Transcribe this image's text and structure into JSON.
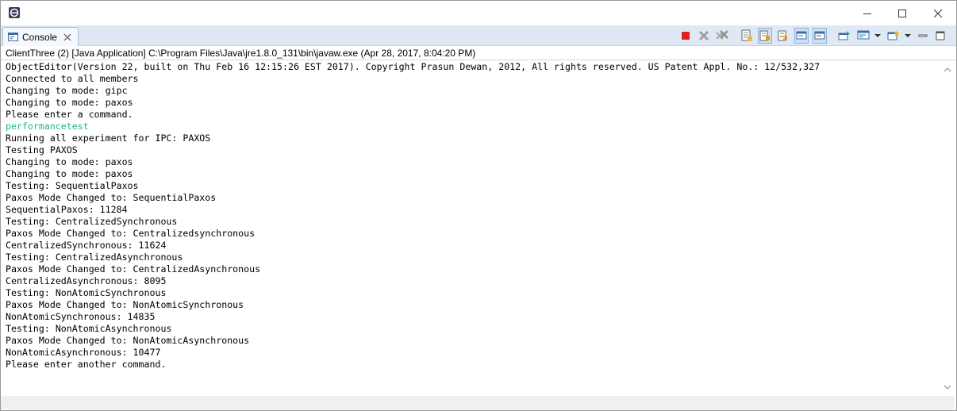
{
  "window": {
    "title": "",
    "app_icon": "eclipse-icon",
    "controls": [
      "minimize-icon",
      "maximize-icon",
      "close-icon"
    ]
  },
  "tab": {
    "label": "Console",
    "icon": "console-icon",
    "close_icon": "close-icon"
  },
  "toolbar": {
    "buttons": [
      {
        "name": "terminate-button",
        "icon": "stop-icon",
        "color": "#e02020"
      },
      {
        "name": "remove-launch-button",
        "icon": "x-icon",
        "color": "#a0a0a0"
      },
      {
        "name": "remove-all-terminated-button",
        "icon": "x-multiple-icon",
        "color": "#a0a0a0"
      },
      {
        "name": "clear-console-button",
        "icon": "clear-icon"
      },
      {
        "name": "scroll-lock-button",
        "icon": "scroll-lock-icon",
        "pressed": true
      },
      {
        "name": "word-wrap-button",
        "icon": "word-wrap-icon"
      },
      {
        "name": "show-on-stdout-button",
        "icon": "stdout-icon",
        "pressed": true
      },
      {
        "name": "show-on-stderr-button",
        "icon": "stderr-icon",
        "pressed": true
      },
      {
        "name": "pin-console-button",
        "icon": "pin-icon"
      },
      {
        "name": "display-console-button",
        "icon": "monitor-icon"
      },
      {
        "name": "open-console-button",
        "icon": "new-console-icon"
      },
      {
        "name": "view-minimize-button",
        "icon": "minimize-icon"
      },
      {
        "name": "view-maximize-button",
        "icon": "maximize-icon"
      }
    ]
  },
  "description": "ClientThree (2) [Java Application] C:\\Program Files\\Java\\jre1.8.0_131\\bin\\javaw.exe (Apr 28, 2017, 8:04:20 PM)",
  "console": {
    "input_color": "#21b884",
    "lines": [
      {
        "text": "ObjectEditor(Version 22, built on Thu Feb 16 12:15:26 EST 2017). Copyright Prasun Dewan, 2012, All rights reserved. US Patent Appl. No.: 12/532,327",
        "type": "output"
      },
      {
        "text": "Connected to all members",
        "type": "output"
      },
      {
        "text": "Changing to mode: gipc",
        "type": "output"
      },
      {
        "text": "Changing to mode: paxos",
        "type": "output"
      },
      {
        "text": "Please enter a command.",
        "type": "output"
      },
      {
        "text": "performancetest",
        "type": "input"
      },
      {
        "text": "Running all experiment for IPC: PAXOS",
        "type": "output"
      },
      {
        "text": "Testing PAXOS",
        "type": "output"
      },
      {
        "text": "Changing to mode: paxos",
        "type": "output"
      },
      {
        "text": "Changing to mode: paxos",
        "type": "output"
      },
      {
        "text": "Testing: SequentialPaxos",
        "type": "output"
      },
      {
        "text": "Paxos Mode Changed to: SequentialPaxos",
        "type": "output"
      },
      {
        "text": "SequentialPaxos: 11284",
        "type": "output"
      },
      {
        "text": "Testing: CentralizedSynchronous",
        "type": "output"
      },
      {
        "text": "Paxos Mode Changed to: Centralizedsynchronous",
        "type": "output"
      },
      {
        "text": "CentralizedSynchronous: 11624",
        "type": "output"
      },
      {
        "text": "Testing: CentralizedAsynchronous",
        "type": "output"
      },
      {
        "text": "Paxos Mode Changed to: CentralizedAsynchronous",
        "type": "output"
      },
      {
        "text": "CentralizedAsynchronous: 8095",
        "type": "output"
      },
      {
        "text": "Testing: NonAtomicSynchronous",
        "type": "output"
      },
      {
        "text": "Paxos Mode Changed to: NonAtomicSynchronous",
        "type": "output"
      },
      {
        "text": "NonAtomicSynchronous: 14835",
        "type": "output"
      },
      {
        "text": "Testing: NonAtomicAsynchronous",
        "type": "output"
      },
      {
        "text": "Paxos Mode Changed to: NonAtomicAsynchronous",
        "type": "output"
      },
      {
        "text": "NonAtomicAsynchronous: 10477",
        "type": "output"
      },
      {
        "text": "Please enter another command.",
        "type": "output"
      }
    ]
  },
  "scrollbar": {
    "up_icon": "chevron-up-icon",
    "down_icon": "chevron-down-icon"
  }
}
